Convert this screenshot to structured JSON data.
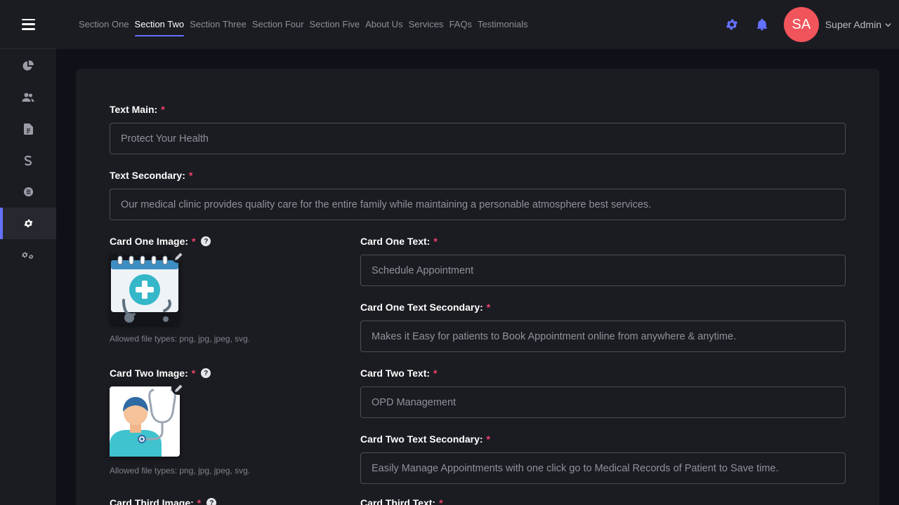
{
  "header": {
    "nav": [
      {
        "label": "Section One",
        "active": false
      },
      {
        "label": "Section Two",
        "active": true
      },
      {
        "label": "Section Three",
        "active": false
      },
      {
        "label": "Section Four",
        "active": false
      },
      {
        "label": "Section Five",
        "active": false
      },
      {
        "label": "About Us",
        "active": false
      },
      {
        "label": "Services",
        "active": false
      },
      {
        "label": "FAQs",
        "active": false
      },
      {
        "label": "Testimonials",
        "active": false
      }
    ],
    "avatar_initials": "SA",
    "user_name": "Super Admin",
    "accent_color": "#6571ff",
    "avatar_color": "#f2545b"
  },
  "sidebar": {
    "items": [
      {
        "icon": "pie-chart-icon",
        "active": false
      },
      {
        "icon": "users-icon",
        "active": false
      },
      {
        "icon": "document-icon",
        "active": false
      },
      {
        "icon": "dollar-icon",
        "active": false
      },
      {
        "icon": "list-circle-icon",
        "active": false
      },
      {
        "icon": "gear-icon",
        "active": true
      },
      {
        "icon": "gears-icon",
        "active": false
      }
    ]
  },
  "form": {
    "required_mark": "*",
    "help_mark": "?",
    "text_main": {
      "label": "Text Main:",
      "placeholder": "Protect Your Health"
    },
    "text_secondary": {
      "label": "Text Secondary:",
      "placeholder": "Our medical clinic provides quality care for the entire family while maintaining a personable atmosphere best services."
    },
    "card_one_image": {
      "label": "Card One Image:",
      "hint": "Allowed file types: png, jpg, jpeg, svg."
    },
    "card_one_text": {
      "label": "Card One Text:",
      "placeholder": "Schedule Appointment"
    },
    "card_one_text_secondary": {
      "label": "Card One Text Secondary:",
      "placeholder": "Makes it Easy for patients to Book Appointment online from anywhere & anytime."
    },
    "card_two_image": {
      "label": "Card Two Image:",
      "hint": "Allowed file types: png, jpg, jpeg, svg."
    },
    "card_two_text": {
      "label": "Card Two Text:",
      "placeholder": "OPD Management"
    },
    "card_two_text_secondary": {
      "label": "Card Two Text Secondary:",
      "placeholder": "Easily Manage Appointments with one click go to Medical Records of Patient to Save time."
    },
    "card_third_image": {
      "label": "Card Third Image:"
    },
    "card_third_text": {
      "label": "Card Third Text:"
    }
  }
}
